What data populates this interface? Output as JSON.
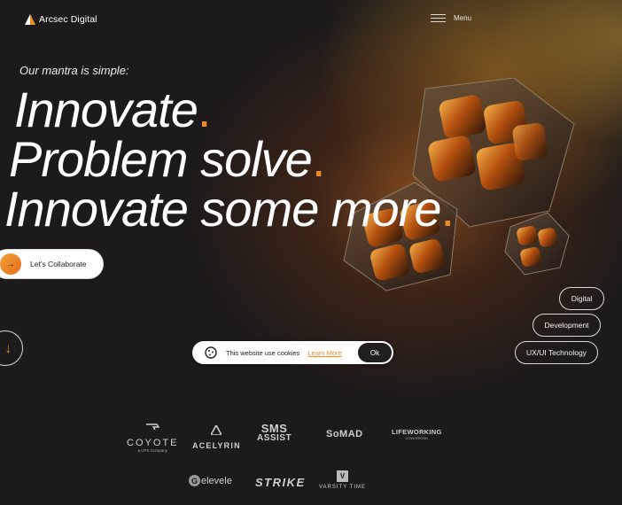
{
  "header": {
    "brand": "Arcsec Digital",
    "menu_label": "Menu"
  },
  "hero": {
    "mantra": "Our mantra is simple:",
    "lines": [
      "Innovate",
      "Problem solve",
      "Innovate some more"
    ],
    "accent_punct": "."
  },
  "cta": {
    "collaborate_label": "Let's Collaborate"
  },
  "services": [
    "Digital",
    "Development",
    "UX/UI Technology"
  ],
  "cookie_banner": {
    "text": "This website use cookies",
    "learn_more": "Learn More",
    "ok": "Ok"
  },
  "clients": {
    "coyote": {
      "name": "COYOTE",
      "sub": "a UPS Company"
    },
    "acelyrin": "ACELYRIN",
    "sms_assist": {
      "line1": "SMS",
      "line2": "ASSIST"
    },
    "somad": "SoMAD",
    "lifeworking": {
      "name": "LIFEWORKING",
      "sub": "COWORKING"
    },
    "elevele": "elevele",
    "strike": "STRIKE",
    "varsity_time": "VARSITY TIME"
  },
  "colors": {
    "background": "#1c1a1a",
    "accent": "#f08a24",
    "text": "#ffffff"
  }
}
